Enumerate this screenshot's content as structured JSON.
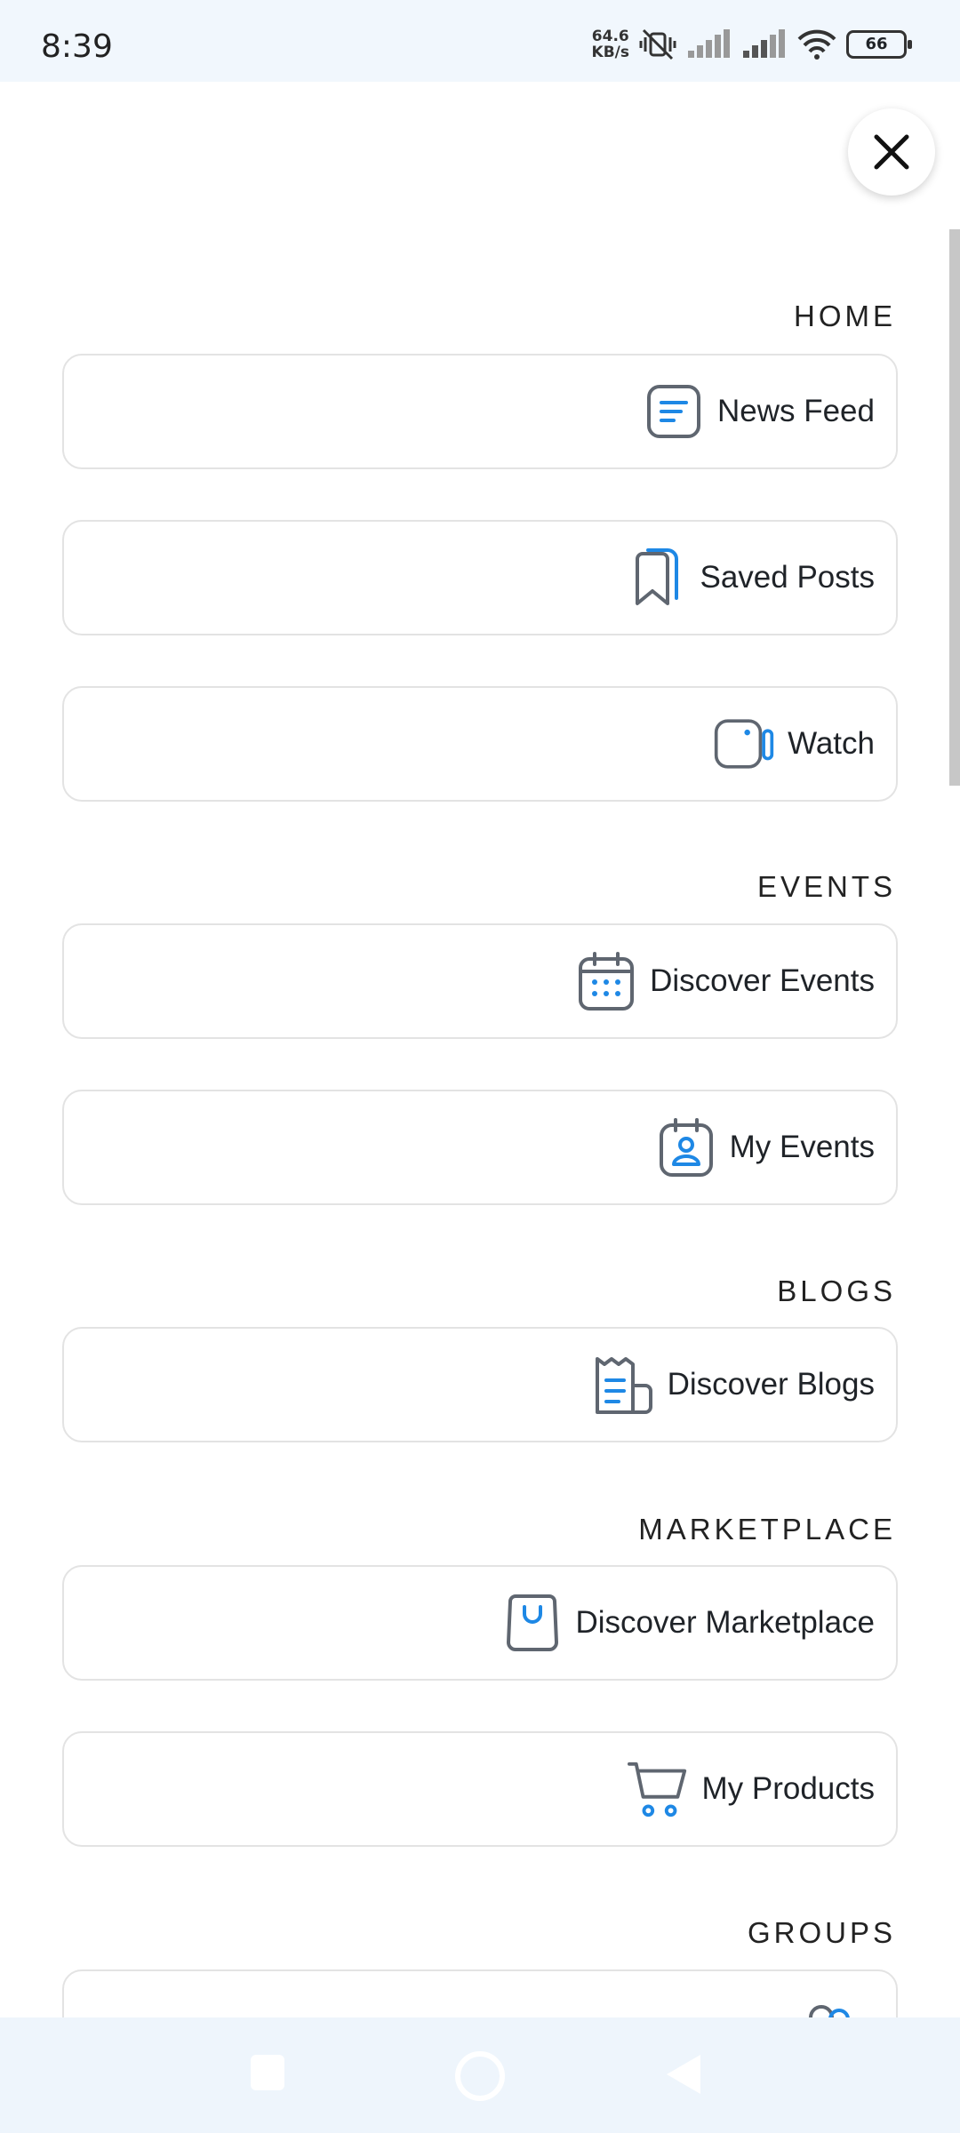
{
  "status": {
    "time": "8:39",
    "net_speed_value": "64.6",
    "net_speed_unit": "KB/s",
    "battery": "66"
  },
  "menu": {
    "sections": [
      {
        "title": "HOME",
        "items": [
          {
            "label": "News Feed",
            "icon": "news-feed-icon"
          },
          {
            "label": "Saved Posts",
            "icon": "bookmark-icon"
          },
          {
            "label": "Watch",
            "icon": "video-icon"
          }
        ]
      },
      {
        "title": "EVENTS",
        "items": [
          {
            "label": "Discover Events",
            "icon": "calendar-icon"
          },
          {
            "label": "My Events",
            "icon": "calendar-user-icon"
          }
        ]
      },
      {
        "title": "BLOGS",
        "items": [
          {
            "label": "Discover Blogs",
            "icon": "newspaper-icon"
          }
        ]
      },
      {
        "title": "MARKETPLACE",
        "items": [
          {
            "label": "Discover Marketplace",
            "icon": "shopping-bag-icon"
          },
          {
            "label": "My Products",
            "icon": "cart-icon"
          }
        ]
      },
      {
        "title": "GROUPS",
        "items": [
          {
            "label": "",
            "icon": "groups-icon"
          }
        ]
      }
    ]
  },
  "colors": {
    "accent": "#1e88e5",
    "icon_gray": "#5f6670",
    "border": "#e3e3e3"
  }
}
